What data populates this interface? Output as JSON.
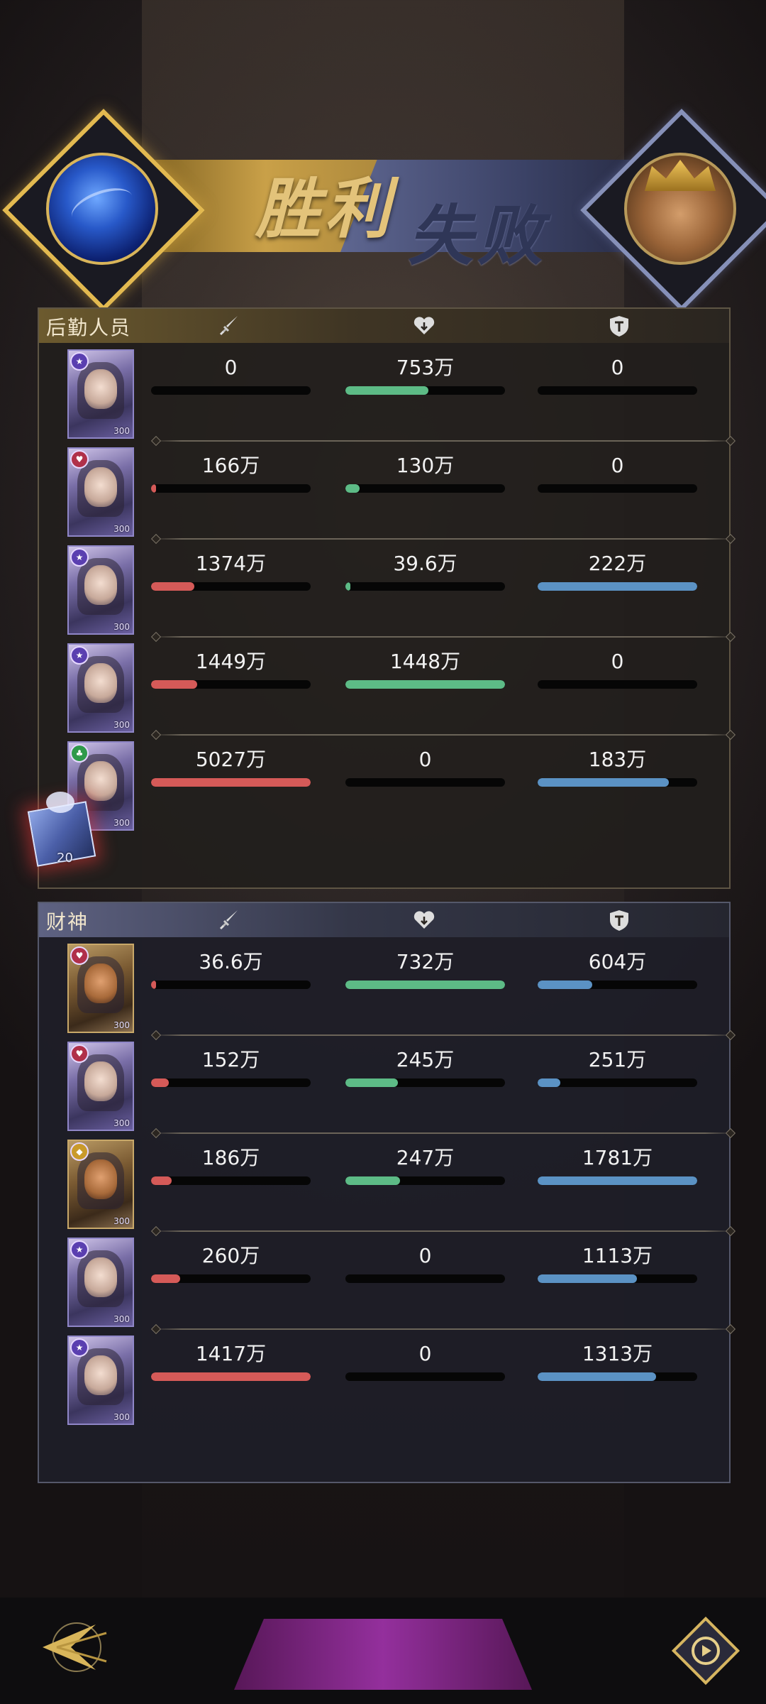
{
  "header": {
    "win_label": "胜利",
    "lose_label": "失败",
    "left_avatar_icon": "galaxy-avatar-icon",
    "right_avatar_icon": "god-of-wealth-avatar-icon"
  },
  "colors": {
    "damage": "#d55a58",
    "heal": "#5dbb86",
    "tank": "#5b92c4",
    "gold_accent": "#e2b950",
    "blue_accent": "#8690b8"
  },
  "column_icons": [
    "sword-icon",
    "heart-icon",
    "shield-icon"
  ],
  "teams": [
    {
      "name": "后勤人员",
      "rows": [
        {
          "card_level": "300",
          "badge": "star",
          "damage": "0",
          "damage_fill": 0.0,
          "heal": "753万",
          "heal_fill": 0.52,
          "tank": "0",
          "tank_fill": 0.0
        },
        {
          "card_level": "300",
          "badge": "heart",
          "damage": "166万",
          "damage_fill": 0.03,
          "heal": "130万",
          "heal_fill": 0.09,
          "tank": "0",
          "tank_fill": 0.0
        },
        {
          "card_level": "300",
          "badge": "star",
          "damage": "1374万",
          "damage_fill": 0.27,
          "heal": "39.6万",
          "heal_fill": 0.03,
          "tank": "222万",
          "tank_fill": 1.0
        },
        {
          "card_level": "300",
          "badge": "star",
          "damage": "1449万",
          "damage_fill": 0.29,
          "heal": "1448万",
          "heal_fill": 1.0,
          "tank": "0",
          "tank_fill": 0.0
        },
        {
          "card_level": "300",
          "badge": "clover",
          "damage": "5027万",
          "damage_fill": 1.0,
          "heal": "0",
          "heal_fill": 0.0,
          "tank": "183万",
          "tank_fill": 0.82
        }
      ]
    },
    {
      "name": "财神",
      "rows": [
        {
          "card_level": "300",
          "badge": "heart",
          "damage": "36.6万",
          "damage_fill": 0.03,
          "heal": "732万",
          "heal_fill": 1.0,
          "tank": "604万",
          "tank_fill": 0.34
        },
        {
          "card_level": "300",
          "badge": "heart",
          "damage": "152万",
          "damage_fill": 0.11,
          "heal": "245万",
          "heal_fill": 0.33,
          "tank": "251万",
          "tank_fill": 0.14
        },
        {
          "card_level": "300",
          "badge": "diamond",
          "damage": "186万",
          "damage_fill": 0.13,
          "heal": "247万",
          "heal_fill": 0.34,
          "tank": "1781万",
          "tank_fill": 1.0
        },
        {
          "card_level": "300",
          "badge": "star",
          "damage": "260万",
          "damage_fill": 0.18,
          "heal": "0",
          "heal_fill": 0.0,
          "tank": "1113万",
          "tank_fill": 0.62
        },
        {
          "card_level": "300",
          "badge": "star",
          "damage": "1417万",
          "damage_fill": 1.0,
          "heal": "0",
          "heal_fill": 0.0,
          "tank": "1313万",
          "tank_fill": 0.74
        }
      ]
    }
  ],
  "gift": {
    "count": "20",
    "icon": "gift-box-icon"
  }
}
